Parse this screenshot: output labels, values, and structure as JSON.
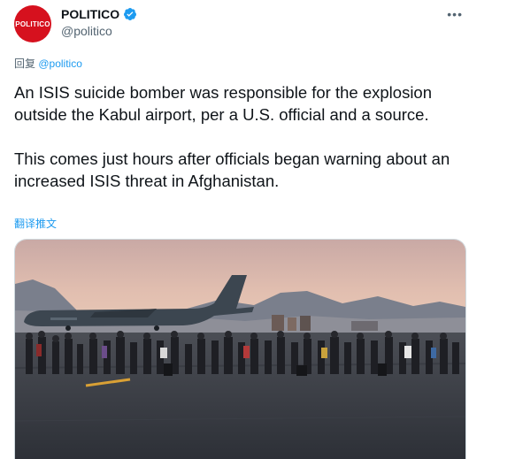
{
  "tweet": {
    "author": {
      "display_name": "POLITICO",
      "handle": "@politico",
      "avatar_text": "POLITICO",
      "verified": true
    },
    "more_label": "•••",
    "reply_prefix": "回复",
    "reply_to": "@politico",
    "paragraphs": [
      "An ISIS suicide bomber was responsible for the explosion outside the Kabul airport, per a U.S. official and a source.",
      "This comes just hours after officials began warning about an increased ISIS threat in Afghanistan."
    ],
    "translate_label": "翻译推文",
    "media": {
      "type": "photo",
      "icon": "photo-airport-evacuation"
    }
  },
  "colors": {
    "brand": "#d6111e",
    "link": "#1d9bf0",
    "muted": "#536471",
    "text": "#0f1419"
  }
}
